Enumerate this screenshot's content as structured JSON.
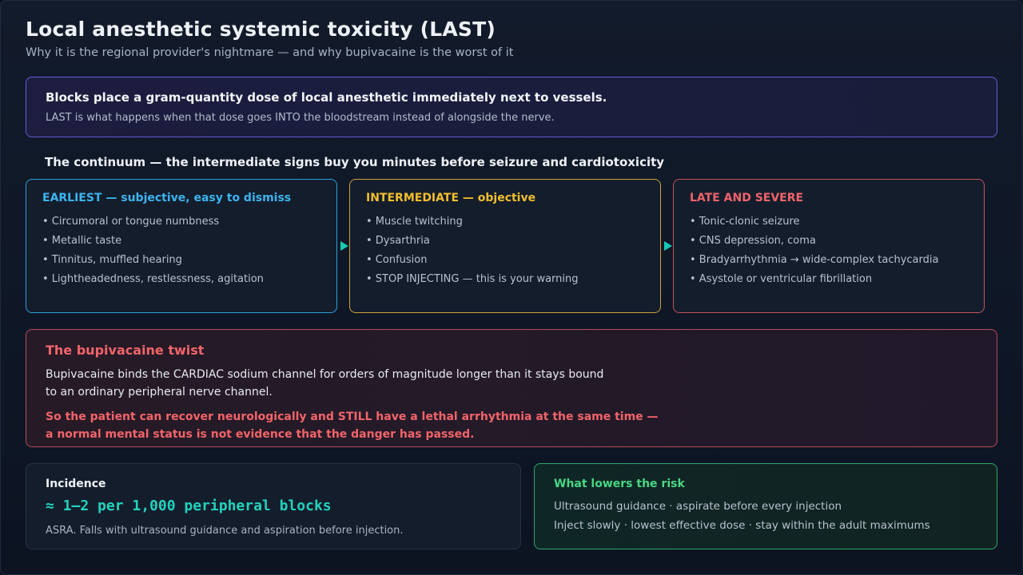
{
  "header": {
    "title": "Local anesthetic systemic toxicity (LAST)",
    "subtitle": "Why it is the regional provider's nightmare — and why bupivacaine is the worst of it"
  },
  "callout": {
    "headline": "Blocks place a gram-quantity dose of local anesthetic immediately next to vessels.",
    "body": "LAST is what happens when that dose goes INTO the bloodstream instead of alongside the nerve."
  },
  "continuum": {
    "heading": "The continuum — the intermediate signs buy you minutes before seizure and cardiotoxicity",
    "stages": [
      {
        "title": "EARLIEST — subjective, easy to dismiss",
        "color": "#3cb4ef",
        "items": [
          "• Circumoral or tongue numbness",
          "• Metallic taste",
          "• Tinnitus, muffled hearing",
          "• Lightheadedness, restlessness, agitation"
        ]
      },
      {
        "title": "INTERMEDIATE — objective",
        "color": "#f2be2c",
        "items": [
          "• Muscle twitching",
          "• Dysarthria",
          "• Confusion",
          "• STOP INJECTING — this is your warning"
        ]
      },
      {
        "title": "LATE AND SEVERE",
        "color": "#f0636b",
        "items": [
          "• Tonic-clonic seizure",
          "• CNS depression, coma",
          "• Bradyarrhythmia → wide-complex tachycardia",
          "• Asystole or ventricular fibrillation"
        ]
      }
    ]
  },
  "twist": {
    "title": "The bupivacaine twist",
    "body_line1": "Bupivacaine binds the CARDIAC sodium channel for orders of magnitude longer than it stays bound",
    "body_line2": "to an ordinary peripheral nerve channel.",
    "warning_line1": "So the patient can recover neurologically and STILL have a lethal arrhythmia at the same time —",
    "warning_line2": "a normal mental status is not evidence that the danger has passed."
  },
  "incidence": {
    "label": "Incidence",
    "value": "≈ 1–2 per 1,000 peripheral blocks",
    "note": "ASRA. Falls with ultrasound guidance and aspiration before injection."
  },
  "risk": {
    "title": "What lowers the risk",
    "line1": "Ultrasound guidance · aspirate before every injection",
    "line2": "Inject slowly · lowest effective dose · stay within the adult maximums"
  }
}
